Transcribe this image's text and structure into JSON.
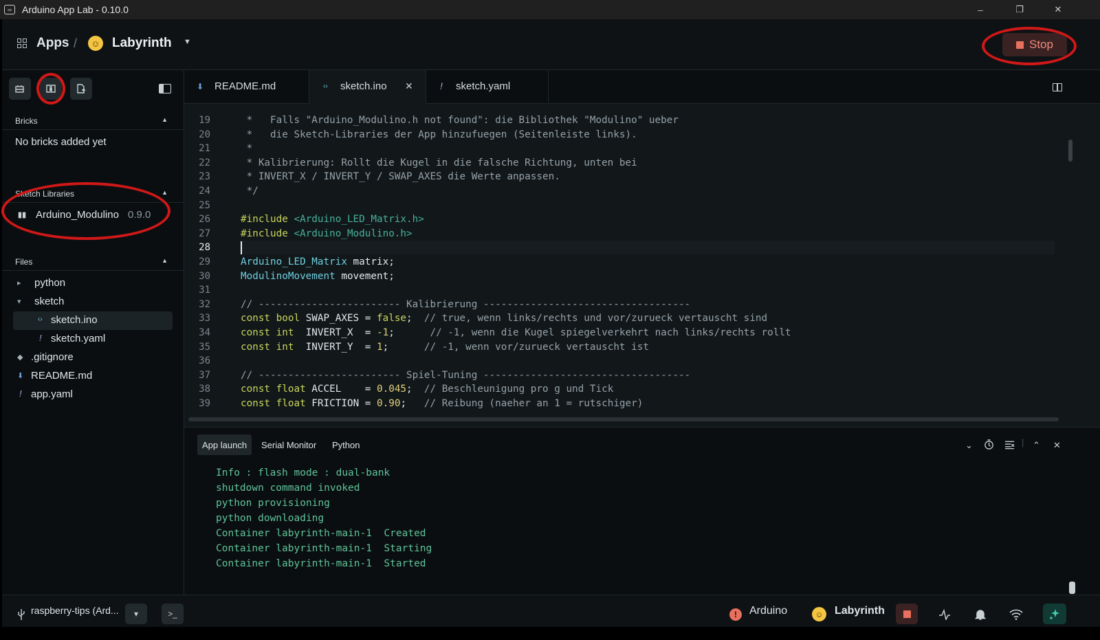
{
  "window": {
    "title": "Arduino App Lab - 0.10.0",
    "minimize": "–",
    "maximize": "❐",
    "close": "✕"
  },
  "header": {
    "apps_label": "Apps",
    "separator": "/",
    "app_name": "Labyrinth",
    "stop_label": "Stop"
  },
  "sidebar": {
    "bricks_title": "Bricks",
    "bricks_empty": "No bricks added yet",
    "libraries_title": "Sketch Libraries",
    "library": {
      "name": "Arduino_Modulino",
      "version": "0.9.0"
    },
    "files_title": "Files",
    "files": [
      {
        "name": "python",
        "icon": "▸"
      },
      {
        "name": "sketch",
        "icon": "▾"
      },
      {
        "name": "sketch.ino",
        "icon": "‹›"
      },
      {
        "name": "sketch.yaml",
        "icon": "!"
      },
      {
        "name": ".gitignore",
        "icon": "◆"
      },
      {
        "name": "README.md",
        "icon": "⬇"
      },
      {
        "name": "app.yaml",
        "icon": "!"
      }
    ]
  },
  "tabs": [
    {
      "name": "README.md",
      "icon": "⬇"
    },
    {
      "name": "sketch.ino",
      "icon": "‹›",
      "close": "✕"
    },
    {
      "name": "sketch.yaml",
      "icon": "!"
    }
  ],
  "editor": {
    "line_numbers": [
      "19",
      "20",
      "21",
      "22",
      "23",
      "24",
      "25",
      "26",
      "27",
      "28",
      "29",
      "30",
      "31",
      "32",
      "33",
      "34",
      "35",
      "36",
      "37",
      "38",
      "39"
    ],
    "lines": [
      " *   Falls \"Arduino_Modulino.h not found\": die Bibliothek \"Modulino\" ueber",
      " *   die Sketch-Libraries der App hinzufuegen (Seitenleiste links).",
      " *",
      " * Kalibrierung: Rollt die Kugel in die falsche Richtung, unten bei",
      " * INVERT_X / INVERT_Y / SWAP_AXES die Werte anpassen.",
      " */",
      "",
      "#include <Arduino_LED_Matrix.h>",
      "#include <Arduino_Modulino.h>",
      "",
      "Arduino_LED_Matrix matrix;",
      "ModulinoMovement movement;",
      "",
      "// ------------------------ Kalibrierung -----------------------------------",
      "const bool SWAP_AXES = false;  // true, wenn links/rechts und vor/zurueck vertauscht sind",
      "const int  INVERT_X  = -1;      // -1, wenn die Kugel spiegelverkehrt nach links/rechts rollt",
      "const int  INVERT_Y  = 1;      // -1, wenn vor/zurueck vertauscht ist",
      "",
      "// ------------------------ Spiel-Tuning -----------------------------------",
      "const float ACCEL    = 0.045;  // Beschleunigung pro g und Tick",
      "const float FRICTION = 0.90;   // Reibung (naeher an 1 = rutschiger)"
    ]
  },
  "console": {
    "tabs": [
      "App launch",
      "Serial Monitor",
      "Python"
    ],
    "log": [
      "Info : flash mode : dual-bank",
      "shutdown command invoked",
      "python provisioning",
      "python downloading",
      "Container labyrinth-main-1  Created",
      "Container labyrinth-main-1  Starting",
      "Container labyrinth-main-1  Started"
    ]
  },
  "statusbar": {
    "board": "raspberry-tips (Ard...",
    "terminal": ">_",
    "arduino_label": "Arduino",
    "app_label": "Labyrinth"
  },
  "colors": {
    "accent_stop": "#e8705e",
    "annotation": "#d01818",
    "log_green": "#5fc49a"
  }
}
